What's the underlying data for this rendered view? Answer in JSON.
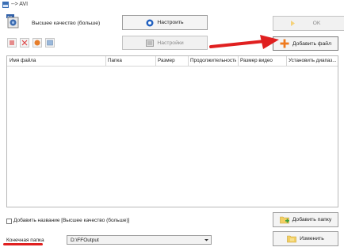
{
  "window": {
    "title": "--> AVI"
  },
  "quality": {
    "label": "Высшее качество (больше)"
  },
  "buttons": {
    "configure": "Настроить",
    "settings": "Настройки",
    "ok": "OK",
    "add_file": "Добавить файл",
    "add_folder": "Добавить папку",
    "change": "Изменить"
  },
  "table": {
    "columns": [
      "Имя файла",
      "Папка",
      "Размер",
      "Продолжительность",
      "Размер видео",
      "Установить диапаз..."
    ]
  },
  "options": {
    "add_name_label": "Добавить название [Высшее качество (больше)]"
  },
  "output": {
    "folder_label": "Конечная папка",
    "folder_value": "D:\\FFOutput"
  },
  "annotation": {
    "arrow_color": "#e02020",
    "underline_color": "#e02020"
  }
}
